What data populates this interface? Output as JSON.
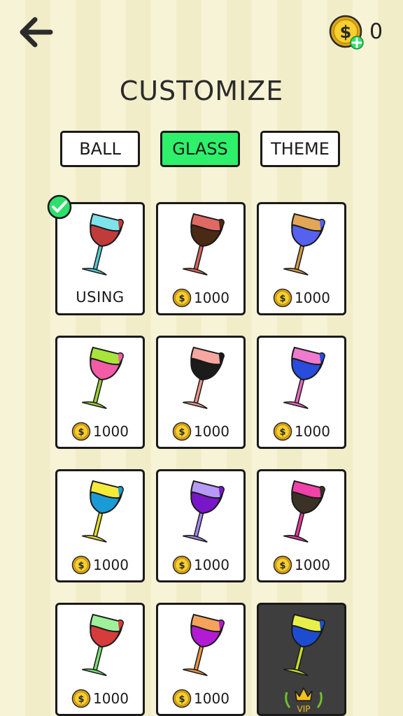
{
  "header": {
    "title": "CUSTOMIZE",
    "coins": "0"
  },
  "tabs": [
    {
      "label": "BALL",
      "active": false
    },
    {
      "label": "GLASS",
      "active": true
    },
    {
      "label": "THEME",
      "active": false
    }
  ],
  "items": [
    {
      "status": "USING",
      "rim": "#7ee3ea",
      "liquid": "#c23b3b",
      "stem": "#56c9d2"
    },
    {
      "price": "1000",
      "rim": "#e06a63",
      "liquid": "#4a2a14",
      "stem": "#d9655c"
    },
    {
      "price": "1000",
      "rim": "#e2a657",
      "liquid": "#5661f0",
      "stem": "#d29a4c"
    },
    {
      "price": "1000",
      "rim": "#a8e53c",
      "liquid": "#f25ca6",
      "stem": "#9ad431"
    },
    {
      "price": "1000",
      "rim": "#f6a8a0",
      "liquid": "#1b1b1b",
      "stem": "#ef958a"
    },
    {
      "price": "1000",
      "rim": "#f07ad0",
      "liquid": "#2a4cdc",
      "stem": "#e86ac3"
    },
    {
      "price": "1000",
      "rim": "#f4ea3a",
      "liquid": "#1b9bd6",
      "stem": "#e7dc2a"
    },
    {
      "price": "1000",
      "rim": "#b69af5",
      "liquid": "#7a16c9",
      "stem": "#a486ee"
    },
    {
      "price": "1000",
      "rim": "#f042a8",
      "liquid": "#3b3226",
      "stem": "#e33a9c"
    },
    {
      "price": "1000",
      "rim": "#9ef09a",
      "liquid": "#d83b3b",
      "stem": "#78de72"
    },
    {
      "price": "1000",
      "rim": "#f6a35a",
      "liquid": "#b21ad4",
      "stem": "#ee9444"
    },
    {
      "vip_label": "VIP",
      "rim": "#e7f04a",
      "liquid": "#1d4cd0",
      "stem": "#c8dc2a"
    }
  ],
  "icons": {
    "back": "arrow-left-icon",
    "coin": "dollar-coin-icon",
    "add": "plus-icon",
    "selected": "checkmark-icon",
    "vip": "crown-icon"
  },
  "colors": {
    "active_tab": "#2ef06b",
    "coin_gold": "#f2c11c",
    "add_green": "#2ee06a",
    "vip_card": "#3e3e3e"
  }
}
